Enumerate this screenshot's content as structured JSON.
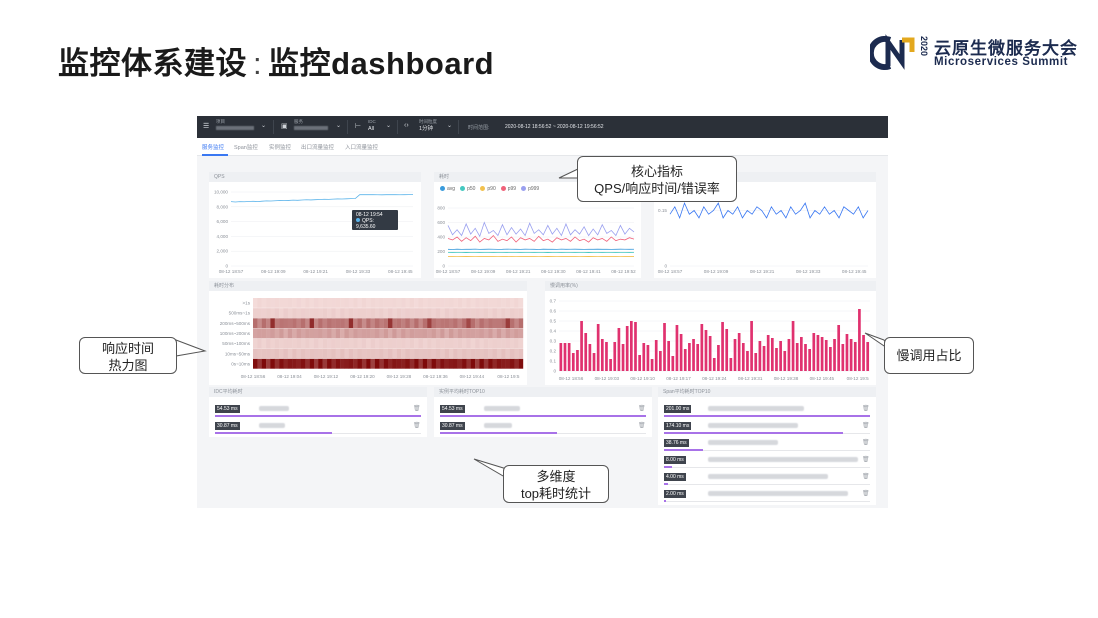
{
  "slide": {
    "title_main": "监控体系建设",
    "title_sep": ":",
    "title_sub": "监控dashboard"
  },
  "logo": {
    "mark": "CN",
    "year": "2020",
    "cn_text": "云原生微服务大会",
    "en_text": "Microservices Summit",
    "colors": {
      "navy": "#1c2b4f",
      "gold": "#e3a81e"
    }
  },
  "dashboard": {
    "topbar": {
      "items": [
        {
          "label": "项目",
          "value": "",
          "icon": "list-icon"
        },
        {
          "label": "服务",
          "value": "",
          "icon": "server-icon"
        },
        {
          "label": "IDC",
          "value": "All",
          "icon": "network-icon"
        },
        {
          "label": "时间粒度",
          "value": "1分钟",
          "icon": "code-icon"
        }
      ],
      "time_range_label": "时间范围:",
      "time_range_value": "2020-08-12 18:56:52 ~ 2020-08-12 19:56:52"
    },
    "tabs": [
      {
        "label": "服务监控",
        "active": true
      },
      {
        "label": "Span监控",
        "active": false
      },
      {
        "label": "实例监控",
        "active": false
      },
      {
        "label": "出口流量监控",
        "active": false
      },
      {
        "label": "入口流量监控",
        "active": false
      }
    ],
    "panels": {
      "qps": {
        "title": "QPS",
        "tooltip_time": "08-12 19:54",
        "tooltip_value": "QPS: 9,635.60"
      },
      "latency": {
        "title": "耗时",
        "legend": [
          "avg",
          "p50",
          "p90",
          "p99",
          "p999"
        ]
      },
      "heatmap": {
        "title": "耗时分布"
      },
      "slow": {
        "title": "慢调用率(%)"
      }
    },
    "lists": {
      "idc": {
        "title": "IDC平均耗时",
        "rows": [
          {
            "value": "54.53 ms",
            "fill": 1.0
          },
          {
            "value": "30.87 ms",
            "fill": 0.57
          }
        ]
      },
      "instance": {
        "title": "实例平均耗时TOP10",
        "rows": [
          {
            "value": "54.53 ms",
            "fill": 1.0
          },
          {
            "value": "30.87 ms",
            "fill": 0.57
          }
        ]
      },
      "span": {
        "title": "Span平均耗时TOP10",
        "rows": [
          {
            "value": "201.00 ms",
            "fill": 1.0
          },
          {
            "value": "174.10 ms",
            "fill": 0.87
          },
          {
            "value": "38.76 ms",
            "fill": 0.19
          },
          {
            "value": "8.00 ms",
            "fill": 0.04
          },
          {
            "value": "4.00 ms",
            "fill": 0.02
          },
          {
            "value": "2.00 ms",
            "fill": 0.01
          }
        ]
      }
    }
  },
  "chart_data": [
    {
      "type": "line",
      "title": "QPS",
      "x": [
        "08-12 18:57",
        "08-12 19:09",
        "08-12 19:21",
        "08-12 19:33",
        "08-12 19:45"
      ],
      "yticks": [
        "0",
        "2,000",
        "4,000",
        "6,000",
        "8,000",
        "10,000"
      ],
      "ylim": [
        0,
        10000
      ],
      "series": [
        {
          "name": "QPS",
          "color": "#5ab3ea",
          "values": [
            8700,
            8650,
            8700,
            8680,
            8720,
            8750,
            8700,
            8760,
            8800,
            8780,
            8820,
            8850,
            8830,
            8860,
            8900,
            8880,
            8920,
            8950,
            8930,
            8960,
            8990,
            9020,
            9000,
            9040,
            9060,
            9050,
            9080,
            9100,
            9120,
            9640,
            9640,
            9635,
            9640,
            9630,
            9620,
            9640,
            9635,
            9640,
            9630,
            9640,
            9645,
            9650
          ]
        }
      ]
    },
    {
      "type": "line",
      "title": "耗时",
      "x": [
        "08-12 18:57",
        "08-12 19:09",
        "08-12 19:21",
        "08-12 19:30",
        "08-12 19:41",
        "08-12 19:52"
      ],
      "yticks": [
        "0",
        "200",
        "400",
        "600",
        "800"
      ],
      "ylim": [
        0,
        800
      ],
      "series": [
        {
          "name": "avg",
          "color": "#3a9bdc",
          "values": [
            230,
            228,
            232,
            229,
            231,
            230,
            233,
            229,
            230,
            232,
            231,
            229,
            230,
            233,
            231,
            230,
            229,
            232,
            231,
            230,
            228,
            232,
            230,
            231,
            229,
            233,
            230,
            231,
            232,
            230,
            229,
            231,
            230,
            232,
            230,
            231,
            229,
            230,
            232,
            231,
            230,
            231
          ]
        },
        {
          "name": "p50",
          "color": "#45c8c0",
          "values": [
            185,
            186,
            184,
            185,
            187,
            185,
            184,
            186,
            185,
            185,
            186,
            184,
            185,
            187,
            185,
            184,
            186,
            185,
            185,
            186,
            184,
            185,
            187,
            185,
            184,
            186,
            185,
            185,
            186,
            184,
            185,
            187,
            185,
            184,
            186,
            185,
            185,
            186,
            184,
            185,
            186,
            185
          ]
        },
        {
          "name": "p90",
          "color": "#f2c14e",
          "values": [
            130,
            131,
            129,
            130,
            132,
            130,
            129,
            131,
            130,
            130,
            131,
            129,
            130,
            132,
            130,
            129,
            131,
            130,
            130,
            131,
            129,
            130,
            132,
            130,
            129,
            131,
            130,
            130,
            131,
            129,
            130,
            132,
            130,
            129,
            131,
            130,
            130,
            131,
            129,
            130,
            131,
            130
          ]
        },
        {
          "name": "p99",
          "color": "#f0627a",
          "values": [
            380,
            360,
            400,
            340,
            390,
            350,
            410,
            330,
            380,
            360,
            420,
            340,
            370,
            350,
            400,
            330,
            390,
            360,
            380,
            340,
            410,
            350,
            370,
            330,
            390,
            360,
            380,
            340,
            400,
            350,
            370,
            330,
            390,
            360,
            380,
            340,
            400,
            350,
            370,
            360,
            390,
            370
          ]
        },
        {
          "name": "p999",
          "color": "#9aa0ef",
          "values": [
            560,
            430,
            500,
            420,
            580,
            440,
            520,
            410,
            600,
            450,
            490,
            420,
            570,
            430,
            530,
            440,
            510,
            420,
            590,
            450,
            500,
            430,
            560,
            440,
            520,
            420,
            580,
            430,
            500,
            440,
            540,
            420,
            510,
            430,
            570,
            450,
            490,
            420,
            560,
            440,
            520,
            470
          ]
        }
      ]
    },
    {
      "type": "line",
      "title": "",
      "x": [
        "08-12 18:57",
        "08-12 19:09",
        "08-12 19:21",
        "08-12 19:33",
        "08-12 19:45"
      ],
      "yticks": [
        "0",
        "0.15"
      ],
      "ylim": [
        0,
        0.2
      ],
      "series": [
        {
          "name": "error",
          "color": "#3a78f2",
          "values": [
            0.14,
            0.16,
            0.13,
            0.17,
            0.14,
            0.15,
            0.13,
            0.16,
            0.14,
            0.15,
            0.17,
            0.13,
            0.15,
            0.14,
            0.16,
            0.13,
            0.15,
            0.14,
            0.16,
            0.15,
            0.13,
            0.16,
            0.14,
            0.15,
            0.13,
            0.16,
            0.14,
            0.15,
            0.17,
            0.13,
            0.15,
            0.14,
            0.16,
            0.14,
            0.15,
            0.13,
            0.16,
            0.15,
            0.14,
            0.16,
            0.13,
            0.15
          ]
        }
      ]
    },
    {
      "type": "heatmap",
      "title": "耗时分布",
      "x": [
        "08-12 18:56",
        "08-12 19:04",
        "08-12 19:12",
        "08-12 19:20",
        "08-12 19:28",
        "08-12 19:36",
        "08-12 19:44",
        "08-12 19:5"
      ],
      "y": [
        ">1s",
        "500ms~1s",
        "200ms~500ms",
        "100ms~200ms",
        "50ms~100ms",
        "10ms~50ms",
        "0s~10ms"
      ],
      "row_intensity": [
        0.08,
        0.12,
        0.55,
        0.35,
        0.12,
        0.18,
        1.0
      ],
      "colors": {
        "low": "#fbe8e6",
        "high": "#7e0a0a"
      }
    },
    {
      "type": "bar",
      "title": "慢调用率(%)",
      "x": [
        "08-12 18:56",
        "08-12 19:03",
        "08-12 19:10",
        "08-12 19:17",
        "08-12 19:24",
        "08-12 19:31",
        "08-12 19:38",
        "08-12 19:45",
        "08-12 19:5"
      ],
      "yticks": [
        "0",
        "0.1",
        "0.2",
        "0.3",
        "0.4",
        "0.5",
        "0.6",
        "0.7"
      ],
      "ylim": [
        0,
        0.7
      ],
      "color": "#e0316f",
      "values": [
        0.28,
        0.28,
        0.28,
        0.18,
        0.21,
        0.5,
        0.38,
        0.27,
        0.18,
        0.47,
        0.32,
        0.29,
        0.12,
        0.29,
        0.43,
        0.27,
        0.45,
        0.5,
        0.49,
        0.16,
        0.28,
        0.26,
        0.12,
        0.31,
        0.2,
        0.48,
        0.3,
        0.15,
        0.46,
        0.37,
        0.22,
        0.28,
        0.32,
        0.27,
        0.47,
        0.41,
        0.35,
        0.13,
        0.26,
        0.49,
        0.42,
        0.13,
        0.32,
        0.38,
        0.28,
        0.2,
        0.5,
        0.18,
        0.3,
        0.25,
        0.36,
        0.33,
        0.23,
        0.3,
        0.2,
        0.32,
        0.5,
        0.28,
        0.34,
        0.27,
        0.22,
        0.38,
        0.36,
        0.34,
        0.31,
        0.24,
        0.32,
        0.46,
        0.27,
        0.37,
        0.32,
        0.29,
        0.62,
        0.36,
        0.29
      ]
    }
  ],
  "callouts": {
    "core": [
      "核心指标",
      "QPS/响应时间/错误率"
    ],
    "heatmap": [
      "响应时间",
      "热力图"
    ],
    "slow": [
      "慢调用占比"
    ],
    "multi": [
      "多维度",
      "top耗时统计"
    ]
  }
}
